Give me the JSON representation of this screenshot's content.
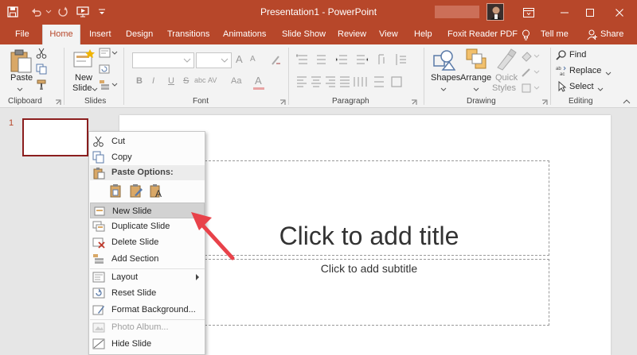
{
  "window": {
    "title": "Presentation1 - PowerPoint"
  },
  "ribbon_tabs": [
    {
      "label": "File"
    },
    {
      "label": "Home"
    },
    {
      "label": "Insert"
    },
    {
      "label": "Design"
    },
    {
      "label": "Transitions"
    },
    {
      "label": "Animations"
    },
    {
      "label": "Slide Show"
    },
    {
      "label": "Review"
    },
    {
      "label": "View"
    },
    {
      "label": "Help"
    },
    {
      "label": "Foxit Reader PDF"
    },
    {
      "label": "Tell me"
    },
    {
      "label": "Share"
    }
  ],
  "ribbon": {
    "clipboard": {
      "paste": "Paste",
      "group": "Clipboard"
    },
    "slides": {
      "new_slide_line1": "New",
      "new_slide_line2": "Slide",
      "group": "Slides"
    },
    "font": {
      "group": "Font",
      "bold": "B",
      "italic": "I",
      "underline": "U",
      "strike": "S",
      "char_spacing": "AV",
      "change_case": "Aa",
      "font_color": "A",
      "grow": "A",
      "shrink": "A"
    },
    "paragraph": {
      "group": "Paragraph"
    },
    "drawing": {
      "shapes": "Shapes",
      "arrange": "Arrange",
      "quick_styles_line1": "Quick",
      "quick_styles_line2": "Styles",
      "group": "Drawing"
    },
    "editing": {
      "find": "Find",
      "replace": "Replace",
      "select": "Select",
      "group": "Editing"
    }
  },
  "thumbnails": [
    {
      "number": "1"
    }
  ],
  "slide": {
    "title_placeholder": "Click to add title",
    "subtitle_placeholder": "Click to add subtitle"
  },
  "context_menu": {
    "items": [
      {
        "label": "Cut",
        "icon": "scissors-icon",
        "enabled": true
      },
      {
        "label": "Copy",
        "icon": "copy-icon",
        "enabled": true
      },
      {
        "label": "Paste Options:",
        "icon": "paste-options-icon",
        "section": true
      },
      {
        "label": "New Slide",
        "icon": "new-slide-icon",
        "enabled": true,
        "highlighted": true
      },
      {
        "label": "Duplicate Slide",
        "icon": "duplicate-slide-icon",
        "enabled": true
      },
      {
        "label": "Delete Slide",
        "icon": "delete-slide-icon",
        "enabled": true
      },
      {
        "label": "Add Section",
        "icon": "add-section-icon",
        "enabled": true
      },
      {
        "label": "Layout",
        "icon": "layout-icon",
        "enabled": true,
        "submenu": true
      },
      {
        "label": "Reset Slide",
        "icon": "reset-slide-icon",
        "enabled": true
      },
      {
        "label": "Format Background...",
        "icon": "format-background-icon",
        "enabled": true
      },
      {
        "label": "Photo Album...",
        "icon": "photo-album-icon",
        "enabled": false
      },
      {
        "label": "Hide Slide",
        "icon": "hide-slide-icon",
        "enabled": true
      }
    ]
  },
  "colors": {
    "brand": "#b7472a",
    "annotation_arrow": "#e8424a"
  }
}
